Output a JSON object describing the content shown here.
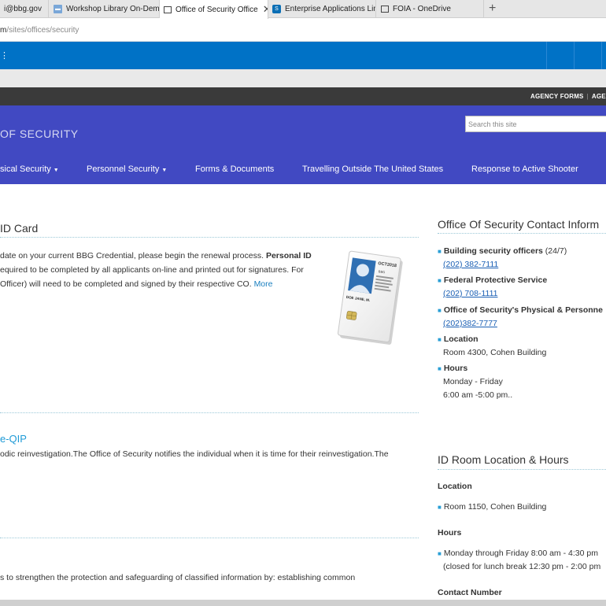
{
  "browser": {
    "tabs": [
      {
        "label": "i@bbg.gov",
        "icon": "mail-icon"
      },
      {
        "label": "Workshop Library On-Dema",
        "icon": "page-icon"
      },
      {
        "label": "Office of Security Office",
        "icon": "tab-page-icon",
        "active": true
      },
      {
        "label": "Enterprise Applications Limi",
        "icon": "sharepoint-icon"
      },
      {
        "label": "FOIA - OneDrive",
        "icon": "onedrive-icon"
      }
    ],
    "new_tab": "+",
    "url_prefix": "m",
    "url_path": "/sites/offices/security"
  },
  "site": {
    "top_links": [
      "AGENCY FORMS",
      "AGENC"
    ],
    "title": "OF SECURITY",
    "search_placeholder": "Search this site",
    "nav": [
      {
        "label": "sical Security",
        "caret": "▼"
      },
      {
        "label": "Personnel Security",
        "caret": "▼"
      },
      {
        "label": "Forms & Documents"
      },
      {
        "label": "Travelling Outside The United States"
      },
      {
        "label": "Response to Active Shooter"
      }
    ]
  },
  "main": {
    "section1": {
      "title": "ID Card",
      "line1_pre": "date on your current BBG Credential, please begin the renewal process. ",
      "line1_bold": "Personal ID",
      "line2": "equired to be completed by all applicants on-line and printed out for signatures. For",
      "line3": "Officer) will need to be completed and signed by their respective CO. ",
      "more": "More",
      "card_text": "OCT2018",
      "card_name": "DOE JANE, M."
    },
    "section2": {
      "title": "e-QIP",
      "line1": "odic reinvestigation.The Office of Security notifies the individual when it is time for their reinvestigation.The"
    },
    "section3": {
      "line1": "s to strengthen the protection and safeguarding of classified information by: establishing common"
    }
  },
  "sidebar": {
    "contact": {
      "title": "Office Of Security Contact Inform",
      "items": [
        {
          "label": "Building security officers",
          "suffix": " (24/7)",
          "phone": "(202) 382-7111"
        },
        {
          "label": "Federal Protective Service",
          "phone": "(202) 708-1111"
        },
        {
          "label": "Office of Security's Physical & Personne",
          "phone": "(202)382-7777"
        },
        {
          "label": "Location",
          "value": "Room 4300, Cohen Building"
        },
        {
          "label": "Hours",
          "value": "Monday - Friday",
          "value2": "6:00 am -5:00 pm.."
        }
      ]
    },
    "idroom": {
      "title": "ID Room Location & Hours",
      "location_label": "Location",
      "location_value": "Room 1150, Cohen Building",
      "hours_label": "Hours",
      "hours_value": "Monday through Friday 8:00 am - 4:30 pm",
      "hours_note": "(closed for lunch break 12:30 pm - 2:00 pm",
      "contact_label": "Contact Number"
    }
  },
  "colors": {
    "sp_bar": "#0072c6",
    "banner": "#4149c2",
    "top_strip": "#3a3a3a",
    "link": "#1a5fb4",
    "accent": "#1e9ad6"
  }
}
